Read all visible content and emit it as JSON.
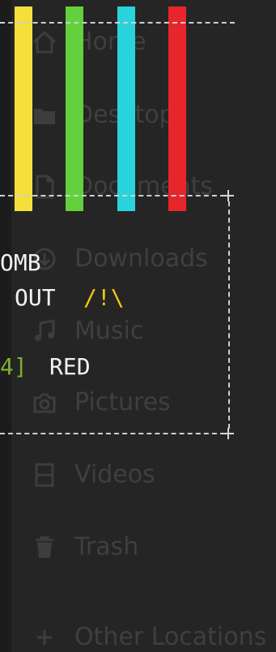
{
  "sidebar": {
    "items": [
      {
        "label": "Home",
        "icon": "home-icon"
      },
      {
        "label": "Desktop",
        "icon": "folder-icon"
      },
      {
        "label": "Documents",
        "icon": "document-icon"
      },
      {
        "label": "Downloads",
        "icon": "download-icon"
      },
      {
        "label": "Music",
        "icon": "music-icon"
      },
      {
        "label": "Pictures",
        "icon": "camera-icon"
      },
      {
        "label": "Videos",
        "icon": "film-icon"
      },
      {
        "label": "Trash",
        "icon": "trash-icon"
      },
      {
        "label": "Other Locations",
        "icon": "plus-icon"
      }
    ]
  },
  "overlay": {
    "bars": [
      "#f4df3c",
      "#62d13d",
      "#29d3db",
      "#e6262b"
    ],
    "line1": "OMB",
    "line2": "OUT",
    "warning_glyph": "/!\\",
    "bracket_text": "4]",
    "line3": "RED",
    "colors": {
      "text": "#f2f2f2",
      "warning": "#f0c419",
      "bracket": "#7fae30",
      "dashes": "#cfcfcf"
    }
  }
}
